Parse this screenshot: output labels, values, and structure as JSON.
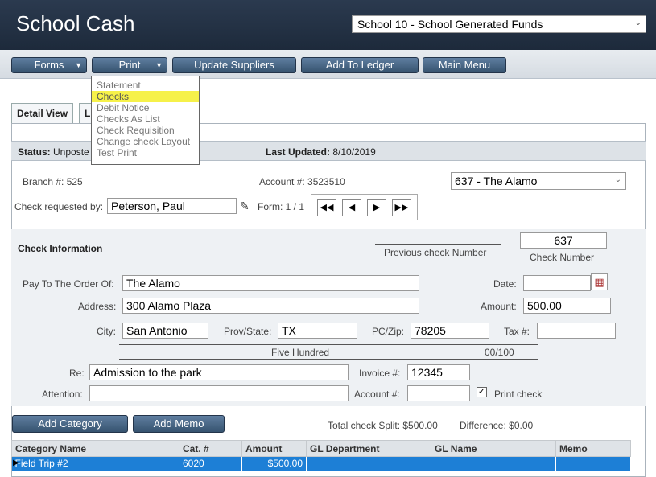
{
  "header": {
    "title": "School Cash",
    "school_select": "School 10 - School Generated Funds"
  },
  "toolbar": {
    "forms": "Forms",
    "print": "Print",
    "update_suppliers": "Update Suppliers",
    "add_to_ledger": "Add To Ledger",
    "main_menu": "Main Menu"
  },
  "print_menu": {
    "items": [
      "Statement",
      "Checks",
      "Debit Notice",
      "Checks As List",
      "Check Requisition",
      "Change check Layout",
      "Test Print"
    ],
    "selected": "Checks"
  },
  "tabs": {
    "detail": "Detail View",
    "second": "L"
  },
  "status": {
    "status_label": "Status:",
    "status_value": "Unposte",
    "updated_label": "Last Updated:",
    "updated_value": "8/10/2019"
  },
  "account": {
    "branch": "Branch #: 525",
    "account": "Account #: 3523510",
    "vendor_select": "637 - The Alamo",
    "requested_label": "Check requested by:",
    "requested_value": "Peterson, Paul",
    "form_label": "Form: 1 / 1"
  },
  "check": {
    "section_title": "Check Information",
    "previous_label": "Previous check Number",
    "check_number": "637",
    "check_number_label": "Check Number",
    "pay_label": "Pay To The Order Of:",
    "pay_value": "The Alamo",
    "date_label": "Date:",
    "date_value": "",
    "address_label": "Address:",
    "address_value": "300 Alamo Plaza",
    "amount_label": "Amount:",
    "amount_value": "500.00",
    "city_label": "City:",
    "city_value": "San Antonio",
    "prov_label": "Prov/State:",
    "prov_value": "TX",
    "zip_label": "PC/Zip:",
    "zip_value": "78205",
    "tax_label": "Tax #:",
    "tax_value": "",
    "amount_words": "Five Hundred",
    "cents": "00/100",
    "re_label": "Re:",
    "re_value": "Admission to the park",
    "invoice_label": "Invoice #:",
    "invoice_value": "12345",
    "attention_label": "Attention:",
    "attention_value": "",
    "account_label": "Account #:",
    "account_value": "",
    "print_check_label": "Print check",
    "print_checked": true
  },
  "actions": {
    "add_category": "Add Category",
    "add_memo": "Add Memo",
    "total_split": "Total check Split: $500.00",
    "difference": "Difference: $0.00"
  },
  "grid": {
    "headers": [
      "Category Name",
      "Cat. #",
      "Amount",
      "GL Department",
      "GL Name",
      "Memo"
    ],
    "rows": [
      [
        "Field Trip #2",
        "6020",
        "$500.00",
        "",
        "",
        ""
      ]
    ]
  }
}
